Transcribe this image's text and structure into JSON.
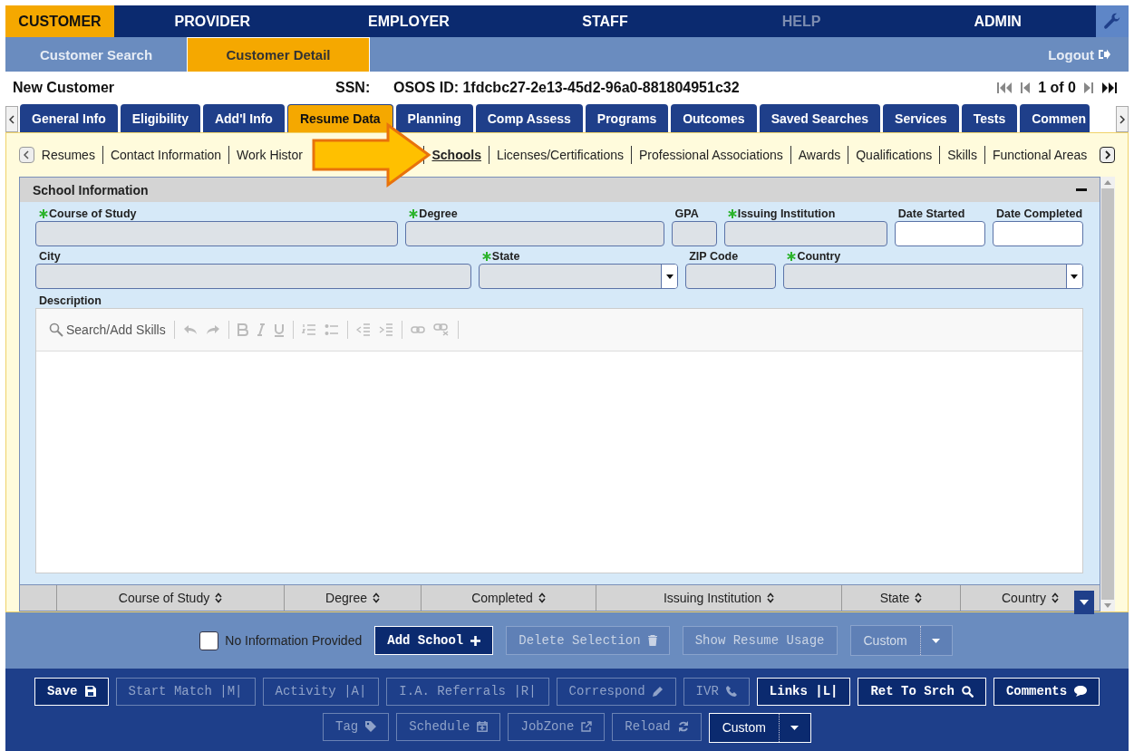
{
  "top_nav": [
    {
      "label": "CUSTOMER",
      "selected": true,
      "disabled": false
    },
    {
      "label": "PROVIDER",
      "selected": false,
      "disabled": false
    },
    {
      "label": "EMPLOYER",
      "selected": false,
      "disabled": false
    },
    {
      "label": "STAFF",
      "selected": false,
      "disabled": false
    },
    {
      "label": "HELP",
      "selected": false,
      "disabled": true
    },
    {
      "label": "ADMIN",
      "selected": false,
      "disabled": false
    }
  ],
  "sub_nav": [
    {
      "label": "Customer Search",
      "selected": false
    },
    {
      "label": "Customer Detail",
      "selected": true
    }
  ],
  "logout": "Logout",
  "record": {
    "name": "New Customer",
    "ssn_label": "SSN:",
    "osos_id": "OSOS ID: 1fdcbc27-2e13-45d2-96a0-881804951c32",
    "pager": "1 of 0"
  },
  "tabs": [
    {
      "label": "General Info",
      "selected": false
    },
    {
      "label": "Eligibility",
      "selected": false
    },
    {
      "label": "Add'l Info",
      "selected": false
    },
    {
      "label": "Resume Data",
      "selected": true
    },
    {
      "label": "Planning",
      "selected": false
    },
    {
      "label": "Comp Assess",
      "selected": false
    },
    {
      "label": "Programs",
      "selected": false
    },
    {
      "label": "Outcomes",
      "selected": false
    },
    {
      "label": "Saved Searches",
      "selected": false
    },
    {
      "label": "Services",
      "selected": false
    },
    {
      "label": "Tests",
      "selected": false
    },
    {
      "label": "Commen",
      "selected": false
    }
  ],
  "subtabs": [
    {
      "label": "Resumes",
      "selected": false
    },
    {
      "label": "Contact Information",
      "selected": false
    },
    {
      "label": "Work Histor",
      "selected": false
    },
    {
      "label": "Schools",
      "selected": true
    },
    {
      "label": "Licenses/Certifications",
      "selected": false
    },
    {
      "label": "Professional Associations",
      "selected": false
    },
    {
      "label": "Awards",
      "selected": false
    },
    {
      "label": "Qualifications",
      "selected": false
    },
    {
      "label": "Skills",
      "selected": false
    },
    {
      "label": "Functional Areas",
      "selected": false
    }
  ],
  "panel": {
    "title": "School Information",
    "rows": [
      [
        {
          "label": "Course of Study",
          "required": true,
          "kind": "text",
          "disabled": true
        },
        {
          "label": "Degree",
          "required": true,
          "kind": "text",
          "disabled": true
        },
        {
          "label": "GPA",
          "required": false,
          "kind": "text",
          "disabled": true
        },
        {
          "label": "Issuing Institution",
          "required": true,
          "kind": "text",
          "disabled": true
        },
        {
          "label": "Date Started",
          "required": false,
          "kind": "text",
          "disabled": false
        },
        {
          "label": "Date Completed",
          "required": false,
          "kind": "text",
          "disabled": false
        }
      ],
      [
        {
          "label": "City",
          "required": false,
          "kind": "text",
          "disabled": true
        },
        {
          "label": "State",
          "required": true,
          "kind": "select",
          "disabled": true
        },
        {
          "label": "ZIP Code",
          "required": false,
          "kind": "text",
          "disabled": true
        },
        {
          "label": "Country",
          "required": true,
          "kind": "select",
          "disabled": true
        }
      ]
    ],
    "description_label": "Description",
    "editor_search": "Search/Add Skills"
  },
  "table": {
    "columns": [
      "Course of Study",
      "Degree",
      "Completed",
      "Issuing Institution",
      "State",
      "Country"
    ]
  },
  "no_info": {
    "label": "No Information Provided",
    "checked": false
  },
  "actions": [
    {
      "label": "Add School",
      "kind": "button",
      "disabled": false
    },
    {
      "label": "Delete Selection",
      "kind": "button",
      "disabled": true
    },
    {
      "label": "Show Resume Usage",
      "kind": "button",
      "disabled": true
    },
    {
      "label": "Custom",
      "kind": "split",
      "disabled": true
    }
  ],
  "footer_rows": [
    [
      {
        "label": "Save",
        "kind": "button",
        "disabled": false
      },
      {
        "label": "Start Match |M|",
        "kind": "button",
        "disabled": true
      },
      {
        "label": "Activity |A|",
        "kind": "button",
        "disabled": true
      },
      {
        "label": "I.A. Referrals |R|",
        "kind": "button",
        "disabled": true
      },
      {
        "label": "Correspond",
        "kind": "button",
        "disabled": true
      },
      {
        "label": "IVR",
        "kind": "button",
        "disabled": true
      },
      {
        "label": "Links |L|",
        "kind": "button",
        "disabled": false
      },
      {
        "label": "Ret To Srch",
        "kind": "button",
        "disabled": false
      },
      {
        "label": "Comments",
        "kind": "button",
        "disabled": false
      }
    ],
    [
      {
        "label": "Tag",
        "kind": "button",
        "disabled": true
      },
      {
        "label": "Schedule",
        "kind": "button",
        "disabled": true
      },
      {
        "label": "JobZone",
        "kind": "button",
        "disabled": true
      },
      {
        "label": "Reload",
        "kind": "button",
        "disabled": true
      },
      {
        "label": "Custom",
        "kind": "split",
        "disabled": false
      }
    ]
  ]
}
